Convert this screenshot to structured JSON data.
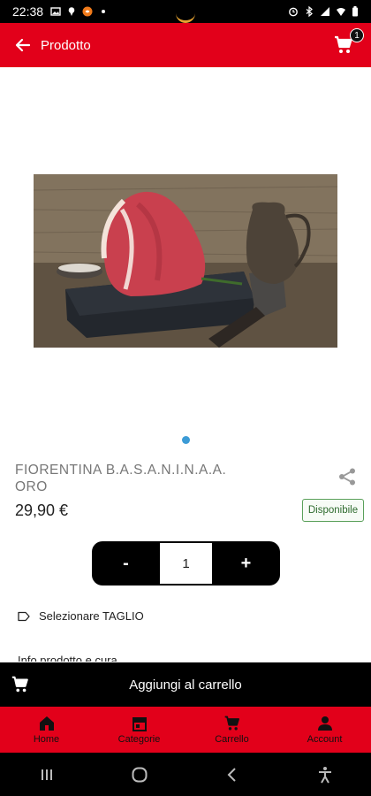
{
  "status_bar": {
    "time": "22:38"
  },
  "header": {
    "title": "Prodotto",
    "cart_count": "1"
  },
  "product": {
    "name": "FIORENTINA B.A.S.A.N.I.N.A.A. ORO",
    "price": "29,90 €",
    "availability": "Disponibile",
    "quantity": "1",
    "decrement_label": "-",
    "increment_label": "+",
    "image_count": 1,
    "current_image": 1
  },
  "options": {
    "select_cut_label": "Selezionare TAGLIO"
  },
  "info": {
    "label": "Info prodotto e cura"
  },
  "add_to_cart": {
    "label": "Aggiungi al carrello"
  },
  "bottom_nav": {
    "items": [
      {
        "label": "Home",
        "icon": "home-icon"
      },
      {
        "label": "Categorie",
        "icon": "store-icon"
      },
      {
        "label": "Carrello",
        "icon": "cart-icon"
      },
      {
        "label": "Account",
        "icon": "person-icon"
      }
    ]
  },
  "colors": {
    "brand_red": "#e2001a",
    "dark": "#000000",
    "dot": "#3c9bd6",
    "available_green": "#5aa05a"
  }
}
